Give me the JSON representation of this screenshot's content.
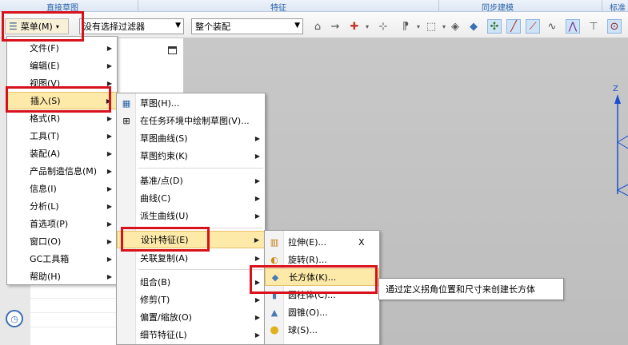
{
  "ribbon_groups": [
    "直接草图",
    "特征",
    "同步建模",
    "标准"
  ],
  "toolbar": {
    "menu_label": "菜单(M)",
    "filter_value": "没有选择过滤器",
    "scope_value": "整个装配"
  },
  "main_menu": {
    "items": [
      {
        "label": "文件(F)",
        "has_sub": true
      },
      {
        "label": "编辑(E)",
        "has_sub": true
      },
      {
        "label": "视图(V)",
        "has_sub": true
      },
      {
        "label": "插入(S)",
        "has_sub": true
      },
      {
        "label": "格式(R)",
        "has_sub": true
      },
      {
        "label": "工具(T)",
        "has_sub": true
      },
      {
        "label": "装配(A)",
        "has_sub": true
      },
      {
        "label": "产品制造信息(M)",
        "has_sub": true
      },
      {
        "label": "信息(I)",
        "has_sub": true
      },
      {
        "label": "分析(L)",
        "has_sub": true
      },
      {
        "label": "首选项(P)",
        "has_sub": true
      },
      {
        "label": "窗口(O)",
        "has_sub": true
      },
      {
        "label": "GC工具箱",
        "has_sub": true
      },
      {
        "label": "帮助(H)",
        "has_sub": true
      }
    ]
  },
  "insert_menu": {
    "items": [
      {
        "label": "草图(H)...",
        "icon": "sketch-icon"
      },
      {
        "label": "在任务环境中绘制草图(V)...",
        "icon": "task-sketch-icon"
      },
      {
        "label": "草图曲线(S)",
        "has_sub": true
      },
      {
        "label": "草图约束(K)",
        "has_sub": true
      },
      {
        "label": "基准/点(D)",
        "has_sub": true
      },
      {
        "label": "曲线(C)",
        "has_sub": true
      },
      {
        "label": "派生曲线(U)",
        "has_sub": true
      },
      {
        "label": "设计特征(E)",
        "has_sub": true
      },
      {
        "label": "关联复制(A)",
        "has_sub": true
      },
      {
        "label": "组合(B)",
        "has_sub": true
      },
      {
        "label": "修剪(T)",
        "has_sub": true
      },
      {
        "label": "偏置/缩放(O)",
        "has_sub": true
      },
      {
        "label": "细节特征(L)",
        "has_sub": true
      }
    ]
  },
  "design_feature_menu": {
    "items": [
      {
        "label": "拉伸(E)...",
        "shortcut": "X",
        "icon": "extrude-icon"
      },
      {
        "label": "旋转(R)...",
        "icon": "revolve-icon"
      },
      {
        "label": "长方体(K)...",
        "icon": "block-icon"
      },
      {
        "label": "圆柱体(C)...",
        "icon": "cylinder-icon"
      },
      {
        "label": "圆锥(O)...",
        "icon": "cone-icon"
      },
      {
        "label": "球(S)...",
        "icon": "sphere-icon"
      }
    ]
  },
  "tooltip": "通过定义拐角位置和尺寸来创建长方体",
  "axis_label": "Z",
  "colors": {
    "highlight_box": "#d8111a",
    "hover": "#fde9a8",
    "ribbon_text": "#2a63a8"
  }
}
